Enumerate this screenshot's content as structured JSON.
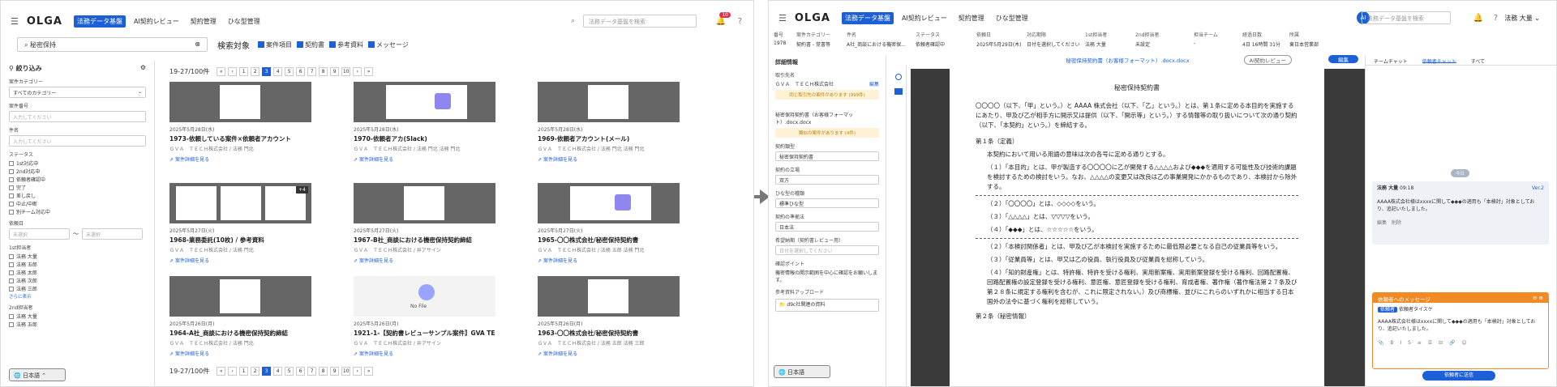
{
  "left": {
    "logo": "OLGA",
    "nav": [
      "法務データ基盤",
      "AI契約レビュー",
      "契約管理",
      "ひな型管理"
    ],
    "header_search_placeholder": "法務データ基盤を検索",
    "notif_count": "10",
    "search_value": "秘密保持",
    "search_targets_label": "検索対象",
    "search_targets": [
      "案件項目",
      "契約書",
      "参考資料",
      "メッセージ"
    ],
    "filter_title": "絞り込み",
    "category_label": "案件カテゴリー",
    "category_value": "すべてのカテゴリー",
    "case_no_label": "案件番号",
    "case_name_label": "件名",
    "input_placeholder": "入力してください",
    "status_label": "ステータス",
    "statuses": [
      "1st対応中",
      "2nd対応中",
      "依頼者確認中",
      "完了",
      "差し戻し",
      "中止/中断",
      "別チーム対応中"
    ],
    "deadline_label": "依頼日",
    "date_placeholder": "未選択",
    "first_label": "1st担当者",
    "first_people": [
      "法務 大量",
      "法務 五郎",
      "法務 太郎",
      "法務 次郎",
      "法務 三郎"
    ],
    "more_label": "さらに表示",
    "second_label": "2nd担当者",
    "second_people": [
      "法務 大量",
      "法務 五郎",
      "法務 三郎"
    ],
    "lang": "日本語",
    "count": "19-27/100件",
    "pages": [
      "1",
      "2",
      "3",
      "4",
      "5",
      "6",
      "7",
      "8",
      "9",
      "10"
    ],
    "current_page": "3",
    "cards": [
      {
        "date": "2025年5月28日(水)",
        "title": "1973-依頼している案件×依頼者アカウント",
        "sub": "ＧＶＡ　ＴＥＣＨ株式会社 / 法務 門北",
        "link": "案件詳細を見る"
      },
      {
        "date": "2025年5月28日(水)",
        "title": "1970-依頼者アカ(Slack)",
        "sub": "ＧＶＡ　ＴＥＣＨ株式会社 / 法務 門北 法務 門北",
        "link": "案件詳細を見る"
      },
      {
        "date": "2025年5月28日(水)",
        "title": "1969-依頼者アカウント(メール)",
        "sub": "ＧＶＡ　ＴＥＣＨ株式会社 / 法務 門北 法務 門北",
        "link": "案件詳細を見る"
      },
      {
        "date": "2025年5月27日(火)",
        "title": "1968-業務委託(10枚) / 参考資料",
        "sub": "ＧＶＡ　ＴＥＣＨ株式会社 / 法務 門北",
        "link": "案件詳細を見る"
      },
      {
        "date": "2025年5月27日(火)",
        "title": "1967-B社_商談における機密保持契約締結",
        "sub": "ＧＶＡ　ＴＥＣＨ株式会社 / 井アサイン",
        "link": "案件詳細を見る"
      },
      {
        "date": "2025年5月27日(火)",
        "title": "1965-〇〇株式会社/秘密保持契約書",
        "sub": "ＧＶＡ　ＴＥＣＨ株式会社 / 法務 五郎 法務 門北",
        "link": "案件詳細を見る"
      },
      {
        "date": "2025年5月26日(月)",
        "title": "1964-A社_商談における機密保持契約締結",
        "sub": "ＧＶＡ　ＴＥＣＨ株式会社 / 法務 門北",
        "link": "案件詳細を見る"
      },
      {
        "date": "2025年5月26日(月)",
        "title": "1921-1-【契約書レビューサンプル案件】GVA TECH株式会社/資",
        "sub": "ＧＶＡ　ＴＥＣＨ株式会社 / 井アサイン",
        "link": "案件詳細を見る"
      },
      {
        "date": "2025年5月26日(月)",
        "title": "1963-〇〇株式会社/秘密保持契約書",
        "sub": "ＧＶＡ　ＴＥＣＨ株式会社 / 法務 五郎 法務 三郎",
        "link": "案件詳細を見る"
      }
    ],
    "nofile": "No File",
    "more_badge": "+4"
  },
  "right": {
    "logo": "OLGA",
    "nav": [
      "法務データ基盤",
      "AI契約レビュー",
      "契約管理",
      "ひな型管理"
    ],
    "ai": "AI",
    "header_search_placeholder": "法務データ基盤を検索",
    "user": "法務 大量",
    "table_headers": [
      "番号",
      "案件カテゴリー",
      "件名",
      "ステータス",
      "依頼日",
      "対応期限",
      "1st担当者",
      "2nd担当者",
      "担当チーム",
      "経過日数",
      "所属"
    ],
    "table_values": [
      "1978",
      "契約書 - 覚書等",
      "A社_商談における機密保...",
      "依頼者確認中",
      "2025年5月29日(木)",
      "日付を選択してください",
      "法務 大量",
      "未設定",
      "-",
      "4日 16時間 31分",
      "東日本営業部"
    ],
    "detail_title": "詳細情報",
    "counterparty_label": "取引先名",
    "counterparty": "ＧＶＡ　ＴＥＣＨ株式会社",
    "edit": "編集",
    "notice1": "同じ取引先の案件があります (999件)",
    "file_name": "秘密保持契約書（お客様フォーマット）.docx.docx",
    "notice2": "類似の案件があります (4件)",
    "type_label": "契約類型",
    "type_value": "秘密保持契約書",
    "position_label": "契約の立場",
    "position_value": "双方",
    "lang_label": "ひな型の種類",
    "lang_value": "標準ひな型",
    "law_label": "契約の準拠法",
    "law_value": "日本法",
    "due_label": "希望納期（契約書レビュー用）",
    "due_value": "日付を選択してください",
    "point_label": "確認ポイント",
    "point_value": "機密情報の開示範囲を中心に確認をお願いします。",
    "upload_label": "参考資料アップロード",
    "upload_file": "d9c社関連の資料",
    "bottom_lang": "日本語",
    "doc_header": "秘密保持契約書（お客様フォーマット）.docx.docx",
    "ai_review_btn": "AI契約レビュー",
    "edit_btn": "編集",
    "doc_title": "秘密保持契約書",
    "doc_intro": "〇〇〇〇（以下、「甲」という。）と AAAA 株式会社（以下、「乙」という。）とは、第１条に定める本目的を実施するにあたり、甲及び乙が相手方に開示又は提供（以下、「開示等」という。）する情報等の取り扱いについて次の通り契約（以下、「本契約」という。）を締結する。",
    "art1": "第１条（定義）",
    "art1_lead": "本契約において用いる用語の意味は次の各号に定める通りとする。",
    "items": [
      "（１）「本目的」とは、甲が製造する〇〇〇〇に乙が開発する△△△△および◆◆◆を適用する可能性及び技術的課題を検討するための検討をいう。なお、△△△△の変更又は改良は乙の事業開発にかかるものであり、本検討から除外する。",
      "（２）「〇〇〇〇」とは、◇◇◇◇をいう。",
      "（３）「△△△△」とは、▽▽▽▽をいう。",
      "（４）「◆◆◆」とは、☆☆☆☆☆をいう。",
      "（２）「本検討関係者」とは、甲及び乙が本検討を実施するために最低限必要となる自己の従業員等をいう。",
      "（３）「従業員等」とは、甲又は乙の役員、執行役員及び従業員を総称していう。",
      "（４）「知的財産権」とは、特許権、特許を受ける権利、実用新案権、実用新案登録を受ける権利、回路配置権、回路配置権の設定登録を受ける権利、意匠権、意匠登録を受ける権利、育成者権、著作権（著作権法第２７条及び第２８条に規定する権利を含むが、これに限定されない。）及び商標権、並びにこれらのいずれかに相当する日本国外の法令に基づく権利を総称していう。"
    ],
    "art2": "第２条（秘密情報）",
    "tab_team": "チームチャット",
    "tab_client": "依頼者チャット",
    "tab_all": "すべて",
    "today": "今日",
    "comment_author": "法務 大量",
    "comment_time": "09:18",
    "comment_version": "Ver.2",
    "comment_body": "AAAA株式会社様はxxxxに関して◆◆◆の適用も「本検討」対象としており、追記いたしました。",
    "comment_actions": "編集　削除",
    "msg_header": "依頼者へのメッセージ",
    "msg_to_tag": "依頼者",
    "msg_to": "依頼者タイスケ",
    "msg_body": "AAAA株式会社様はxxxxに関して◆◆◆の適用も「本検討」対象としており、追記いたしました。",
    "send_btn": "依頼者に送信"
  }
}
